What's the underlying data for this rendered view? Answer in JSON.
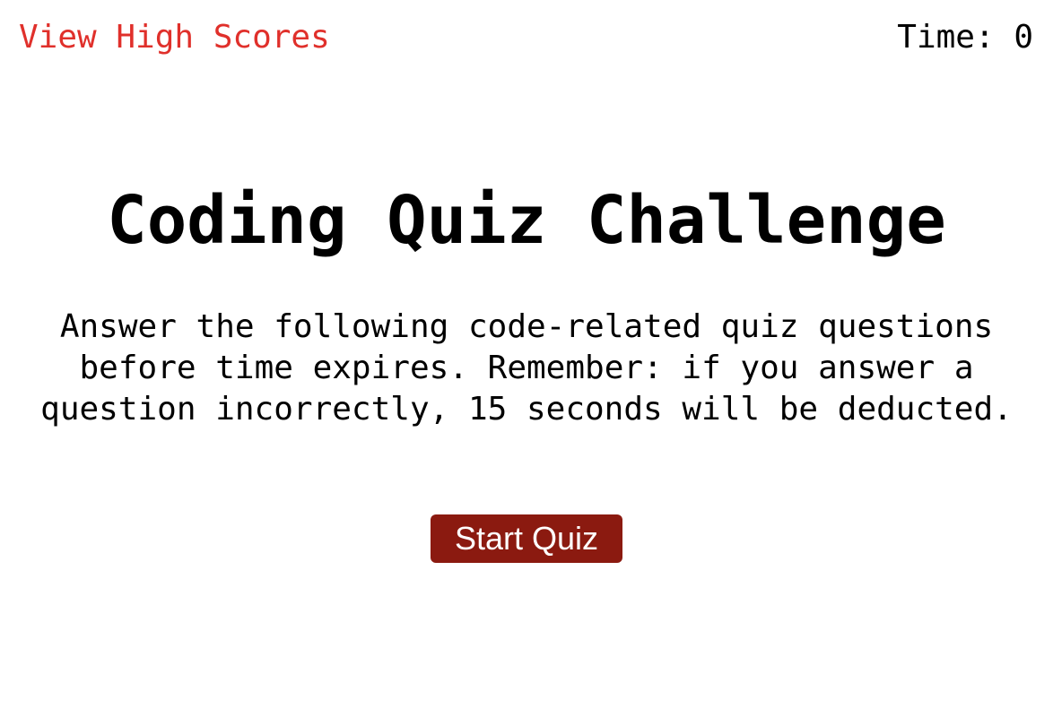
{
  "header": {
    "high_scores_label": "View High Scores",
    "timer_label": "Time: ",
    "timer_value": "0"
  },
  "main": {
    "title": "Coding Quiz Challenge",
    "intro": "Answer the following code-related quiz questions before time expires. Remember: if you answer a question incorrectly, 15 seconds will be deducted.",
    "start_button_label": "Start Quiz"
  },
  "colors": {
    "link": "#e0302b",
    "button_bg": "#8b1a10",
    "button_text": "#ffffff",
    "text": "#000000",
    "background": "#ffffff"
  }
}
